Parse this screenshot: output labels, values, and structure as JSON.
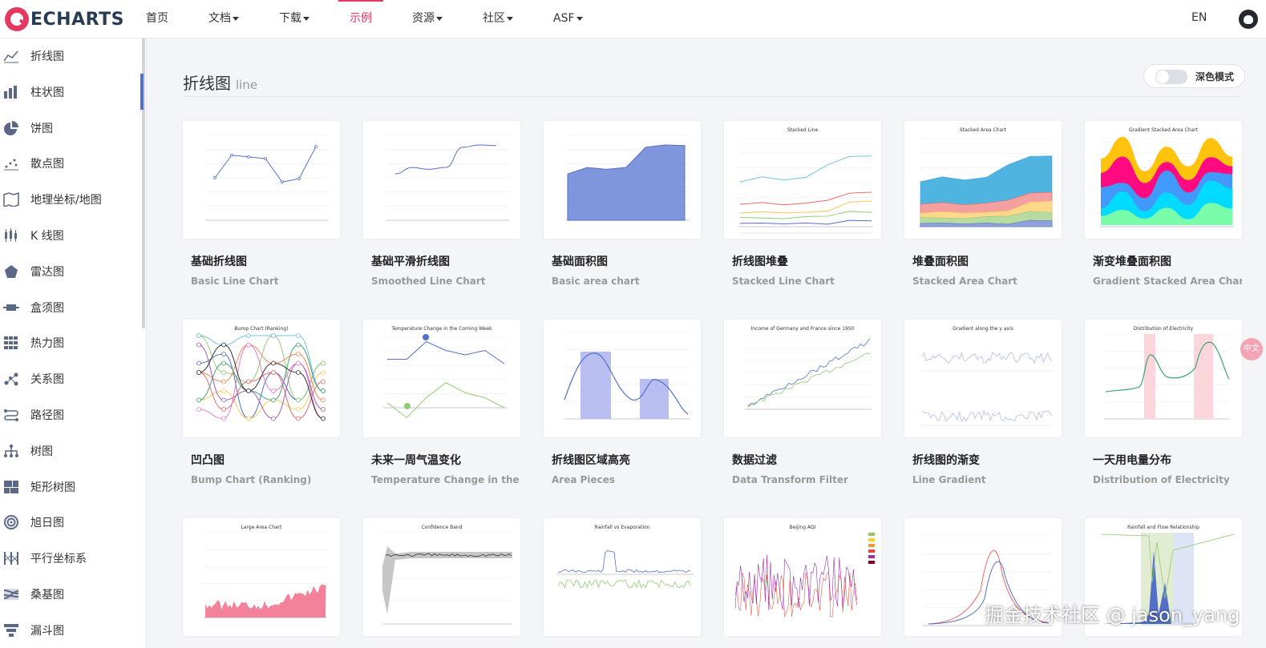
{
  "brand": {
    "name": "ECHARTS",
    "accent": "#e43961"
  },
  "nav": {
    "items": [
      {
        "label": "首页",
        "dropdown": false,
        "active": false
      },
      {
        "label": "文档",
        "dropdown": true,
        "active": false
      },
      {
        "label": "下载",
        "dropdown": true,
        "active": false
      },
      {
        "label": "示例",
        "dropdown": false,
        "active": true
      },
      {
        "label": "资源",
        "dropdown": true,
        "active": false
      },
      {
        "label": "社区",
        "dropdown": true,
        "active": false
      },
      {
        "label": "ASF",
        "dropdown": true,
        "active": false
      }
    ],
    "lang": "EN",
    "github_icon": "github-icon"
  },
  "sidebar": {
    "items": [
      {
        "label": "折线图",
        "icon": "line-chart-icon"
      },
      {
        "label": "柱状图",
        "icon": "bar-chart-icon",
        "active": true
      },
      {
        "label": "饼图",
        "icon": "pie-chart-icon"
      },
      {
        "label": "散点图",
        "icon": "scatter-icon"
      },
      {
        "label": "地理坐标/地图",
        "icon": "map-icon"
      },
      {
        "label": "K 线图",
        "icon": "candlestick-icon"
      },
      {
        "label": "雷达图",
        "icon": "radar-icon"
      },
      {
        "label": "盒须图",
        "icon": "boxplot-icon"
      },
      {
        "label": "热力图",
        "icon": "heatmap-icon"
      },
      {
        "label": "关系图",
        "icon": "graph-icon"
      },
      {
        "label": "路径图",
        "icon": "lines-icon"
      },
      {
        "label": "树图",
        "icon": "tree-icon"
      },
      {
        "label": "矩形树图",
        "icon": "treemap-icon"
      },
      {
        "label": "旭日图",
        "icon": "sunburst-icon"
      },
      {
        "label": "平行坐标系",
        "icon": "parallel-icon"
      },
      {
        "label": "桑基图",
        "icon": "sankey-icon"
      },
      {
        "label": "漏斗图",
        "icon": "funnel-icon"
      }
    ]
  },
  "main": {
    "title": "折线图",
    "subtitle": "line",
    "dark_mode_label": "深色模式",
    "cards": [
      {
        "title": "基础折线图",
        "subtitle": "Basic Line Chart"
      },
      {
        "title": "基础平滑折线图",
        "subtitle": "Smoothed Line Chart"
      },
      {
        "title": "基础面积图",
        "subtitle": "Basic area chart"
      },
      {
        "title": "折线图堆叠",
        "subtitle": "Stacked Line Chart"
      },
      {
        "title": "堆叠面积图",
        "subtitle": "Stacked Area Chart"
      },
      {
        "title": "渐变堆叠面积图",
        "subtitle": "Gradient Stacked Area Chart"
      },
      {
        "title": "凹凸图",
        "subtitle": "Bump Chart (Ranking)"
      },
      {
        "title": "未来一周气温变化",
        "subtitle": "Temperature Change in the C..."
      },
      {
        "title": "折线图区域高亮",
        "subtitle": "Area Pieces"
      },
      {
        "title": "数据过滤",
        "subtitle": "Data Transform Filter"
      },
      {
        "title": "折线图的渐变",
        "subtitle": "Line Gradient"
      },
      {
        "title": "一天用电量分布",
        "subtitle": "Distribution of Electricity"
      },
      {
        "title": "",
        "subtitle": ""
      },
      {
        "title": "",
        "subtitle": ""
      },
      {
        "title": "",
        "subtitle": ""
      },
      {
        "title": "",
        "subtitle": ""
      },
      {
        "title": "",
        "subtitle": ""
      },
      {
        "title": "",
        "subtitle": ""
      }
    ],
    "thumb_titles": [
      "",
      "",
      "",
      "Stacked Line",
      "Stacked Area Chart",
      "Gradient Stacked Area Chart",
      "Bump Chart (Ranking)",
      "Temperature Change in the Coming Week",
      "",
      "Income of Germany and France since 1950",
      "Gradient along the y axis",
      "Distribution of Electricity",
      "Large Area Chart",
      "Confidence Band",
      "Rainfall vs Evaporation",
      "Beijing AQI",
      "",
      "Rainfall and Flow Relationship"
    ]
  },
  "float_badge": "中文",
  "watermark": "掘金技术社区 @ jason_yang"
}
